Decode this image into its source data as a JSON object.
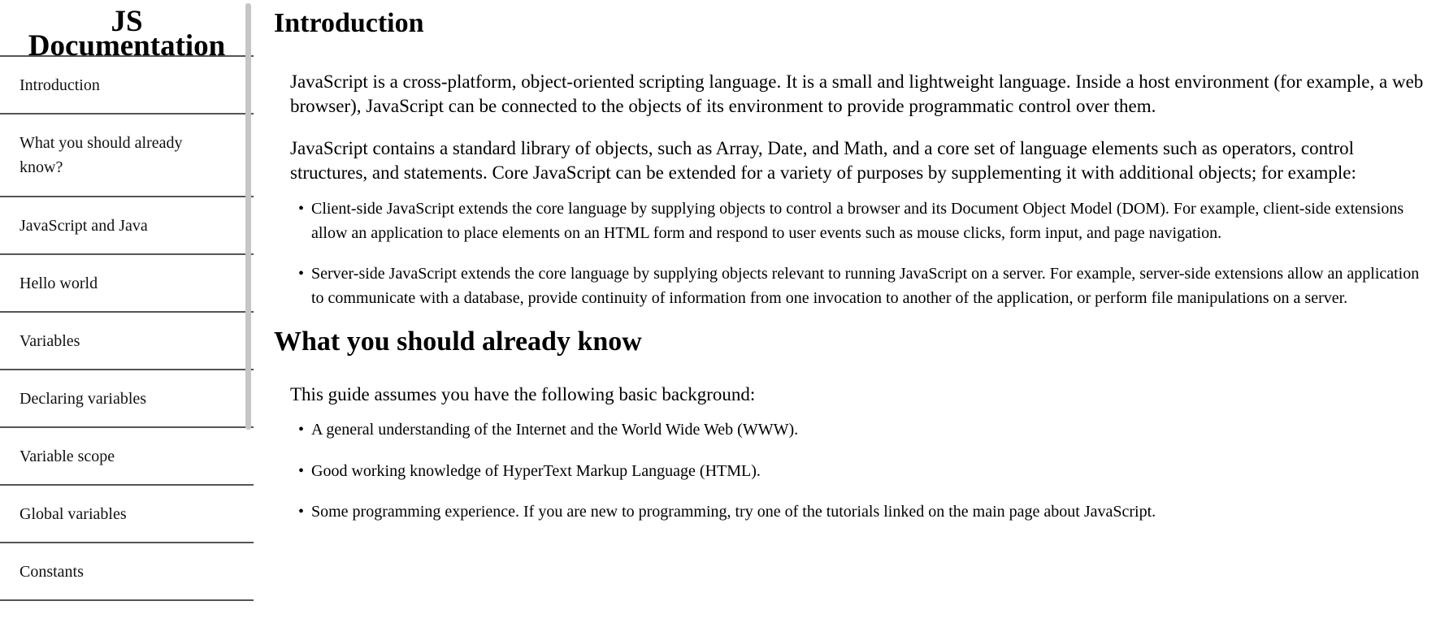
{
  "navbar": {
    "title_line1": "JS",
    "title_line2": "Documentation",
    "items": [
      {
        "label": "Introduction"
      },
      {
        "label": "What you should already know?"
      },
      {
        "label": "JavaScript and Java"
      },
      {
        "label": "Hello world"
      },
      {
        "label": "Variables"
      },
      {
        "label": "Declaring variables"
      },
      {
        "label": "Variable scope"
      },
      {
        "label": "Global variables"
      },
      {
        "label": "Constants"
      }
    ]
  },
  "main": {
    "introduction": {
      "title": "Introduction",
      "paragraphs": [
        "JavaScript is a cross-platform, object-oriented scripting language. It is a small and lightweight language. Inside a host environment (for example, a web browser), JavaScript can be connected to the objects of its environment to provide programmatic control over them.",
        "JavaScript contains a standard library of objects, such as Array, Date, and Math, and a core set of language elements such as operators, control structures, and statements. Core JavaScript can be extended for a variety of purposes by supplementing it with additional objects; for example:"
      ],
      "bullets": [
        "Client-side JavaScript extends the core language by supplying objects to control a browser and its Document Object Model (DOM). For example, client-side extensions allow an application to place elements on an HTML form and respond to user events such as mouse clicks, form input, and page navigation.",
        "Server-side JavaScript extends the core language by supplying objects relevant to running JavaScript on a server. For example, server-side extensions allow an application to communicate with a database, provide continuity of information from one invocation to another of the application, or perform file manipulations on a server."
      ]
    },
    "what_you_should_know": {
      "title": "What you should already know",
      "paragraph": "This guide assumes you have the following basic background:",
      "bullets": [
        "A general understanding of the Internet and the World Wide Web (WWW).",
        "Good working knowledge of HyperText Markup Language (HTML).",
        "Some programming experience. If you are new to programming, try one of the tutorials linked on the main page about JavaScript."
      ]
    }
  }
}
